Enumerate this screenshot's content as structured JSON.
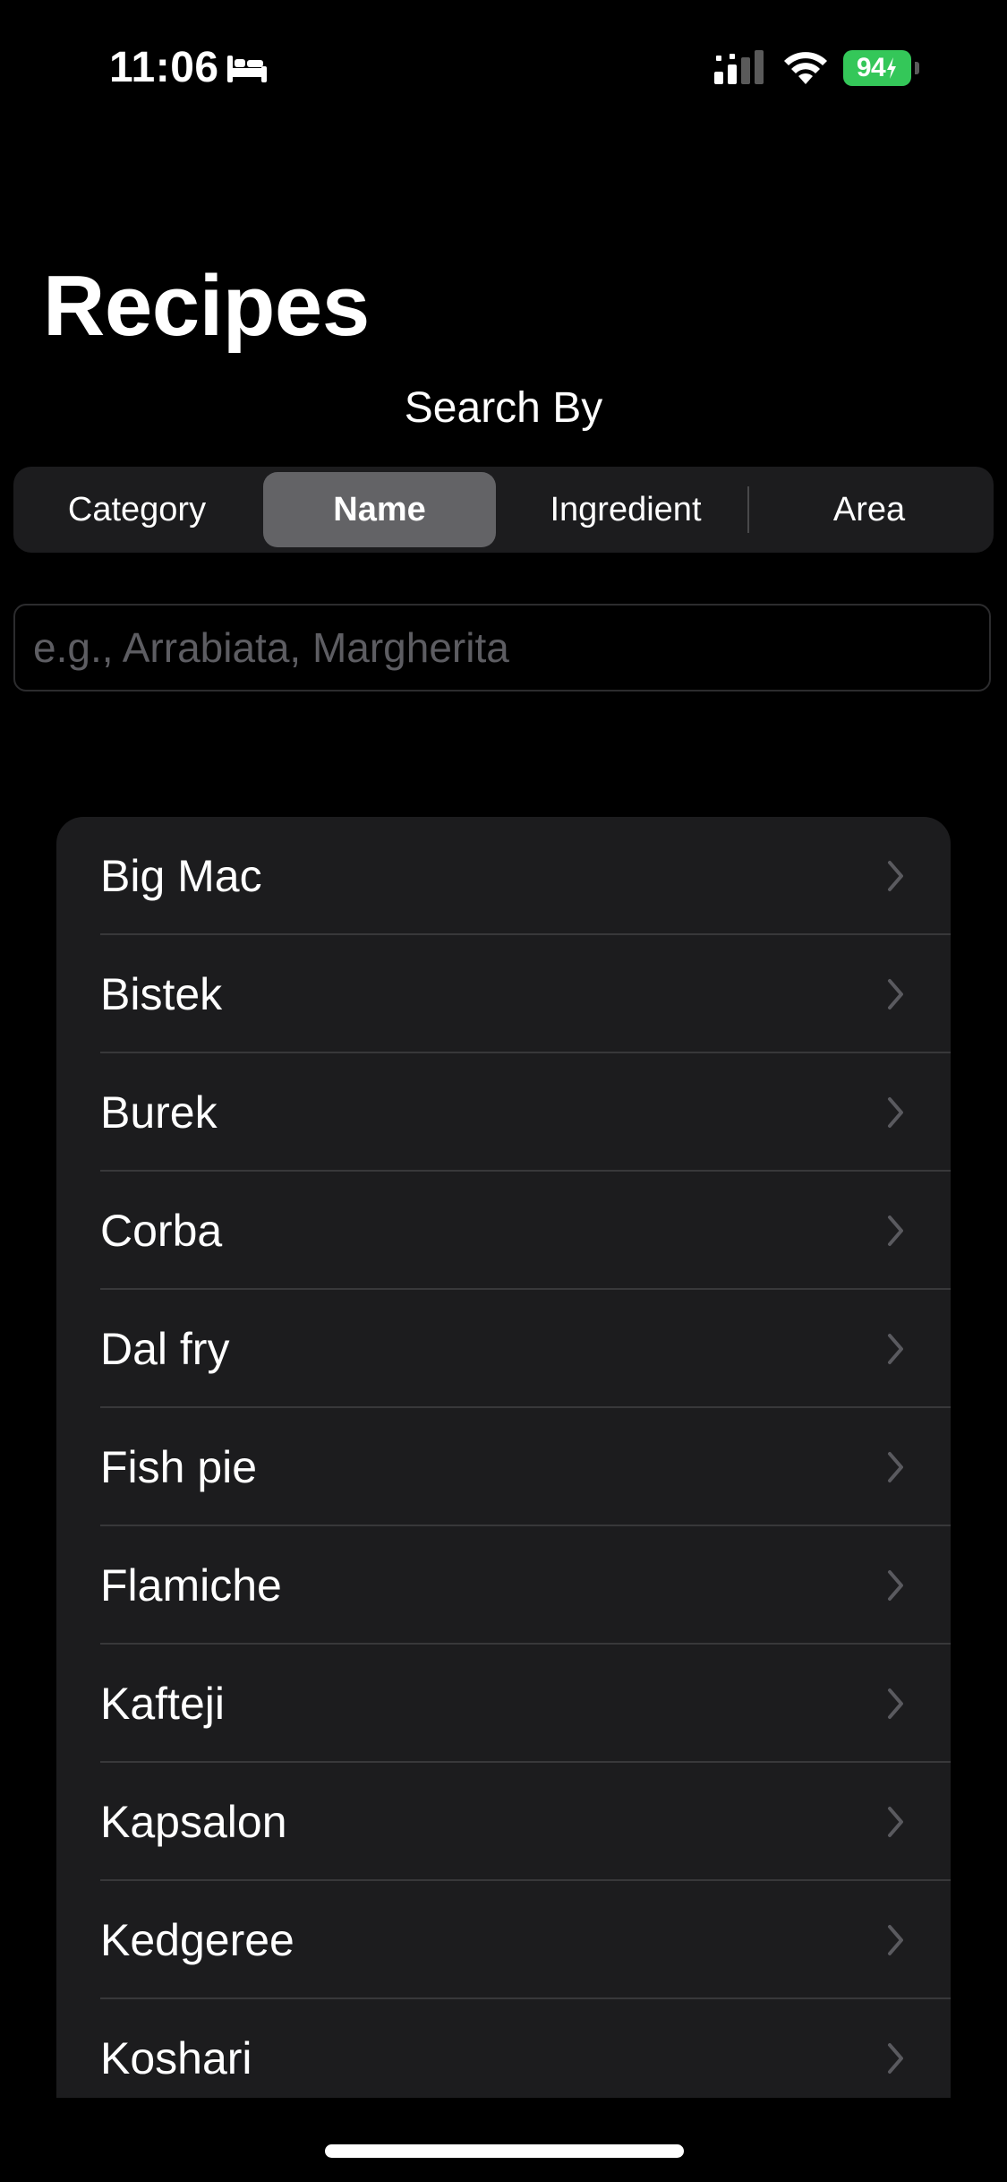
{
  "status_bar": {
    "time": "11:06",
    "battery": "94"
  },
  "header": {
    "title": "Recipes",
    "search_by_label": "Search By"
  },
  "segmented_control": {
    "segments": [
      "Category",
      "Name",
      "Ingredient",
      "Area"
    ],
    "selected": "Name"
  },
  "search": {
    "placeholder": "e.g., Arrabiata, Margherita",
    "value": ""
  },
  "recipes": [
    "Big Mac",
    "Bistek",
    "Burek",
    "Corba",
    "Dal fry",
    "Fish pie",
    "Flamiche",
    "Kafteji",
    "Kapsalon",
    "Kedgeree",
    "Koshari"
  ],
  "colors": {
    "background": "#000000",
    "card": "#1c1c1e",
    "selected_segment": "#636366",
    "battery": "#34c759",
    "chevron": "#5a5a5f"
  },
  "icons": {
    "bed": "bed-icon",
    "signal": "cellular-signal-icon",
    "wifi": "wifi-icon",
    "chevron": "chevron-right-icon"
  }
}
